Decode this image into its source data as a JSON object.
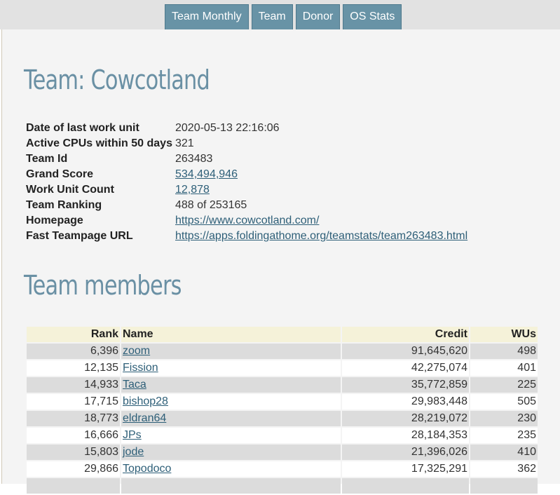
{
  "nav": {
    "tabs": [
      {
        "label": "Team Monthly"
      },
      {
        "label": "Team"
      },
      {
        "label": "Donor"
      },
      {
        "label": "OS Stats"
      }
    ]
  },
  "team": {
    "title": "Team: Cowcotland",
    "info": [
      {
        "key": "Date of last work unit",
        "value": "2020-05-13 22:16:06"
      },
      {
        "key": "Active CPUs within 50 days",
        "value": "321"
      },
      {
        "key": "Team Id",
        "value": "263483"
      },
      {
        "key": "Grand Score",
        "value": "534,494,946"
      },
      {
        "key": "Work Unit Count",
        "value": "12,878"
      },
      {
        "key": "Team Ranking",
        "value": "488 of 253165"
      },
      {
        "key": "Homepage",
        "value": "https://www.cowcotland.com/"
      },
      {
        "key": "Fast Teampage URL",
        "value": "https://apps.foldingathome.org/teamstats/team263483.html"
      }
    ]
  },
  "members": {
    "title": "Team members",
    "columns": {
      "rank": "Rank",
      "name": "Name",
      "credit": "Credit",
      "wus": "WUs"
    },
    "rows": [
      {
        "rank": "6,396",
        "name": "zoom",
        "credit": "91,645,620",
        "wus": "498"
      },
      {
        "rank": "12,135",
        "name": "Fission",
        "credit": "42,275,074",
        "wus": "401"
      },
      {
        "rank": "14,933",
        "name": "Taca",
        "credit": "35,772,859",
        "wus": "225"
      },
      {
        "rank": "17,715",
        "name": "bishop28",
        "credit": "29,983,448",
        "wus": "505"
      },
      {
        "rank": "18,773",
        "name": "eldran64",
        "credit": "28,219,072",
        "wus": "230"
      },
      {
        "rank": "16,666",
        "name": "JPs",
        "credit": "28,184,353",
        "wus": "235"
      },
      {
        "rank": "15,803",
        "name": "jode",
        "credit": "21,396,026",
        "wus": "410"
      },
      {
        "rank": "29,866",
        "name": "Topodoco",
        "credit": "17,325,291",
        "wus": "362"
      }
    ]
  }
}
